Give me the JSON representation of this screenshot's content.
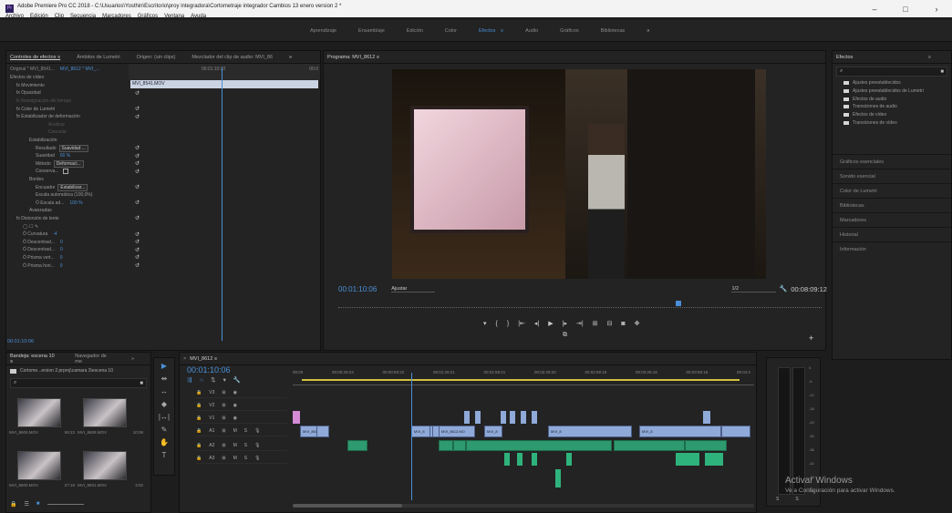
{
  "window": {
    "title": "Adobe Premiere Pro CC 2018 - C:\\Usuarios\\Yosthin\\Escritorio\\proy integradora\\Cortometraje integrador Cambios 13 enero version 2 *",
    "app_icon": "Pr",
    "controls": [
      "minimize-icon",
      "maximize-icon",
      "close-icon"
    ],
    "control_glyphs": [
      "–",
      "□",
      "›"
    ]
  },
  "menu": [
    "Archivo",
    "Edición",
    "Clip",
    "Secuencia",
    "Marcadores",
    "Gráficos",
    "Ventana",
    "Ayuda"
  ],
  "workspaces": {
    "items": [
      "Aprendizaje",
      "Ensamblaje",
      "Edición",
      "Color",
      "Efectos",
      "Audio",
      "Gráficos",
      "Bibliotecas"
    ],
    "active": "Efectos",
    "more": "»",
    "active_menu": "≡"
  },
  "source_panel": {
    "tabs": [
      "Controles de efectos ≡",
      "Ámbitos de Lumetri",
      "Origen: (sin clips)",
      "Mezclador del clip de audio: MVI_86",
      "»"
    ],
    "master": "Original * MVI_8541...",
    "sequence": "MVI_8612 * MVI_...",
    "mini_time": "00:01:10:22",
    "mini_end": "00:0",
    "clip_name": "MVI_8541.MOV",
    "timecode": "00:01:10:06"
  },
  "effect_controls": [
    {
      "label": "Efectos de vídeo",
      "indent": 0
    },
    {
      "label": "fx  Movimiento",
      "indent": 1,
      "reset": "↺"
    },
    {
      "label": "fx  Opacidad",
      "indent": 1,
      "reset": "↺"
    },
    {
      "label": "fx  Reasignación del tiempo",
      "indent": 1,
      "dim": true
    },
    {
      "label": "fx  Color de Lumetri",
      "indent": 1,
      "reset": "↺"
    },
    {
      "label": "fx  Estabilizador de deformación",
      "indent": 1,
      "reset": "↺"
    },
    {
      "label": "Analizar",
      "indent": 6,
      "dim": true
    },
    {
      "label": "Cancelar",
      "indent": 6,
      "dim": true
    },
    {
      "label": "Estabilización",
      "indent": 3
    },
    {
      "label": "Resultado",
      "indent": 4,
      "dropdown": "Suavidad ...",
      "reset": "↺"
    },
    {
      "label": "Suavidad",
      "indent": 4,
      "value": "60 %",
      "reset": "↺"
    },
    {
      "label": "Método",
      "indent": 4,
      "dropdown": "Deformaci...",
      "reset": "↺"
    },
    {
      "label": "Conserva...",
      "indent": 4,
      "check": true,
      "reset": "↺"
    },
    {
      "label": "Bordes",
      "indent": 3
    },
    {
      "label": "Encuadre",
      "indent": 4,
      "dropdown": "Estabilizar...",
      "reset": "↺"
    },
    {
      "label": "Escala automática (100,0%)",
      "indent": 4
    },
    {
      "label": "Ö  Escala ad...",
      "indent": 4,
      "value": "100 %",
      "reset": "↺"
    },
    {
      "label": "Avanzadas",
      "indent": 3
    },
    {
      "label": "fx  Distorsión de lente",
      "indent": 1,
      "reset": "↺"
    },
    {
      "label": "◯ ☐ ✎",
      "indent": 2
    },
    {
      "label": "Ö  Curvatura",
      "indent": 2,
      "value": "-4",
      "reset": "↺"
    },
    {
      "label": "Ö  Descentrad...",
      "indent": 2,
      "value": "0",
      "reset": "↺"
    },
    {
      "label": "Ö  Descentrad...",
      "indent": 2,
      "value": "0",
      "reset": "↺"
    },
    {
      "label": "Ö  Prisma vert...",
      "indent": 2,
      "value": "0",
      "reset": "↺"
    },
    {
      "label": "Ö  Prisma hori...",
      "indent": 2,
      "value": "0",
      "reset": "↺"
    }
  ],
  "program": {
    "tab": "Programa: MVI_8612 ≡",
    "timecode": "00:01:10:06",
    "fit": "Ajustar",
    "quality": "1/2",
    "duration": "00:08:09:12"
  },
  "transport_icons": [
    "marker-icon",
    "in-point-icon",
    "out-point-icon",
    "go-to-in-icon",
    "step-back-icon",
    "play-icon",
    "step-forward-icon",
    "go-to-out-icon",
    "insert-icon",
    "overwrite-icon",
    "export-frame-icon",
    "button-editor-icon",
    "comparison-icon"
  ],
  "transport_glyphs": [
    "▾",
    "{",
    "}",
    "|⇤",
    "◂|",
    "▶",
    "|▸",
    "⇥|",
    "⊞",
    "⊟",
    "◙",
    "✥",
    "⧉"
  ],
  "effects_panel": {
    "title": "Efectos",
    "menu": "≡",
    "search_glyph": "⌕",
    "new_bin": "■",
    "items": [
      "Ajustes preestablecidos",
      "Ajustes preestablecidos de Lumetri",
      "Efectos de audio",
      "Transiciones de audio",
      "Efectos de vídeo",
      "Transiciones de vídeo"
    ],
    "sections": [
      "Gráficos esenciales",
      "Sonido esencial",
      "Color de Lumetri",
      "Bibliotecas",
      "Marcadores",
      "Historial",
      "Información"
    ]
  },
  "project": {
    "tabs": [
      "Bandeja: escena 10 ≡",
      "Navegador de me",
      "»"
    ],
    "path": "Cortome...ersion 2.prproj\\camara 3\\escena 10",
    "clips": [
      {
        "name": "MVI_8609.MOV",
        "duration": "59:23"
      },
      {
        "name": "MVI_8608.MOV",
        "duration": "10:08"
      },
      {
        "name": "MVI_8600.MOV",
        "duration": "27:18"
      },
      {
        "name": "MVI_8601.MOV",
        "duration": "3:02"
      }
    ]
  },
  "tools": [
    "▶",
    "⇹",
    "↔",
    "◆",
    "|↔|",
    "✎",
    "✋",
    "T"
  ],
  "timeline": {
    "tab": "MVI_8612 ≡",
    "close": "×",
    "timecode": "00:01:10:06",
    "ruler": [
      "00;00",
      "00:00:29:23",
      "00:00:59:22",
      "00:01:29:21",
      "00:01:59:21",
      "00:02:29:20",
      "00:02:59:19",
      "00:03:29:18",
      "00:03:59:18",
      "00:04:2"
    ],
    "tracks_v": [
      "V3",
      "V2",
      "V1"
    ],
    "tracks_a": [
      "A1",
      "A2",
      "A3"
    ],
    "clip_labels": [
      "MVI_8612.MOV",
      "MVI_8",
      "MVI_8612.MO",
      "MVI_8",
      "MVI_8",
      "MVI_8"
    ],
    "meter_scale": [
      "0",
      "-6",
      "-12",
      "-18",
      "-24",
      "-30",
      "-36",
      "-42",
      "-48",
      "-54"
    ],
    "meter_footer": [
      "S",
      "S"
    ]
  },
  "watermark": {
    "line1": "Activar Windows",
    "line2": "Ve a Configuración para activar Windows."
  },
  "colors": {
    "accent": "#4a8fd6",
    "playhead": "#4a8fd6",
    "clip_video": "#8fa9d8",
    "clip_audio": "#2e9a6f",
    "panel": "#232323"
  }
}
